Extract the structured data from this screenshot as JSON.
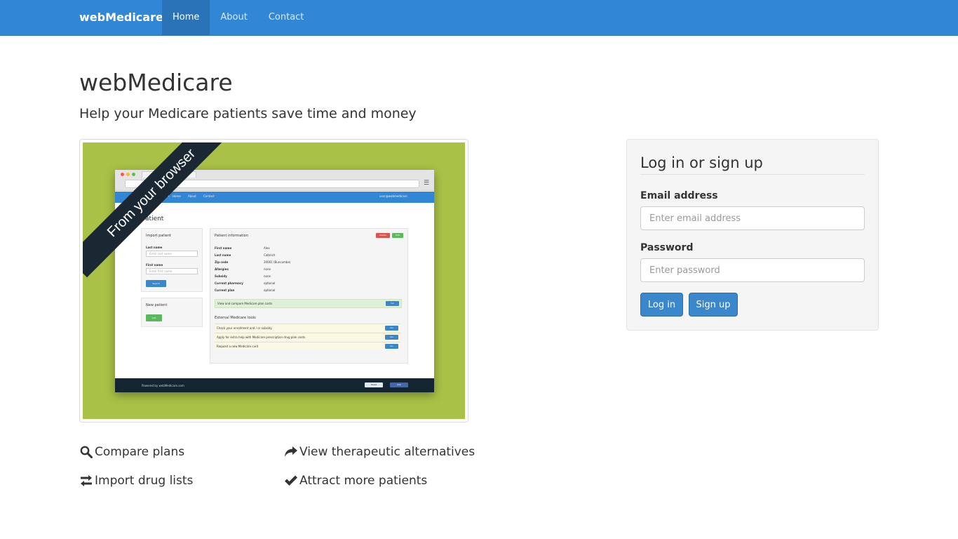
{
  "navbar": {
    "brand": "webMedicare",
    "items": [
      {
        "label": "Home",
        "active": true
      },
      {
        "label": "About",
        "active": false
      },
      {
        "label": "Contact",
        "active": false
      }
    ],
    "color": "#3187d6"
  },
  "hero": {
    "title": "webMedicare",
    "subtitle": "Help your Medicare patients save time and money"
  },
  "preview": {
    "ribbon": "From your browser",
    "bg_color": "#a9c146",
    "brand": "webMedicare",
    "nav": [
      "Home",
      "About",
      "Contact"
    ],
    "user": "user@webmedicare",
    "page_title": "Patient",
    "import_panel": {
      "title": "Import patient",
      "last_name_label": "Last name",
      "last_name_placeholder": "Enter last name",
      "first_name_label": "First name",
      "first_name_placeholder": "Enter first name",
      "search_label": "Search"
    },
    "new_panel": {
      "title": "New patient",
      "add_label": "Add"
    },
    "info_panel": {
      "title": "Patient information",
      "delete_label": "Delete",
      "edit_label": "Edit",
      "rows": [
        {
          "label": "First name",
          "value": "Alex"
        },
        {
          "label": "Last name",
          "value": "Calbrich"
        },
        {
          "label": "Zip code",
          "value": "20001 (Buncombe)"
        },
        {
          "label": "Allergies",
          "value": "none"
        },
        {
          "label": "Subsidy",
          "value": "none"
        },
        {
          "label": "Current pharmacy",
          "value": "optional"
        },
        {
          "label": "Current plan",
          "value": "optional"
        }
      ],
      "compare_text": "View and compare Medicare plan costs",
      "compare_btn": "Go",
      "tools_title": "External Medicare tools",
      "tools": [
        "Check your enrollment and / or subsidy",
        "Apply for extra help with Medicare prescription drug plan costs",
        "Request a new Medicare card"
      ],
      "tools_btn": "Go"
    },
    "footer_text": "Powered by webMedicare.com",
    "share_labels": [
      "Tweet",
      "Like"
    ]
  },
  "features": [
    {
      "icon": "search-icon",
      "label": "Compare plans"
    },
    {
      "icon": "share-arrow-icon",
      "label": "View therapeutic alternatives"
    },
    {
      "icon": "transfer-icon",
      "label": "Import drug lists"
    },
    {
      "icon": "checkmark-icon",
      "label": "Attract more patients"
    }
  ],
  "login": {
    "title": "Log in or sign up",
    "email_label": "Email address",
    "email_placeholder": "Enter email address",
    "email_value": "",
    "password_label": "Password",
    "password_placeholder": "Enter password",
    "password_value": "",
    "login_button": "Log in",
    "signup_button": "Sign up"
  }
}
